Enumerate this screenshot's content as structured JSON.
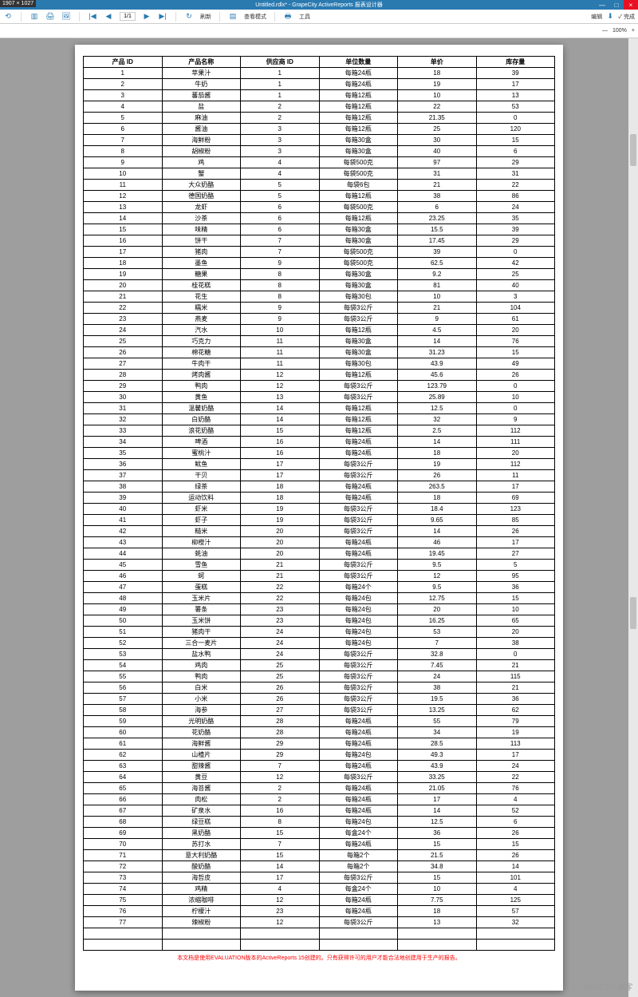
{
  "dim_label": "1907 × 1027",
  "title": "Untitled.rdlx* - GrapeCity ActiveReports 报表设计器",
  "win": {
    "min": "—",
    "max": "□",
    "close": "×"
  },
  "top_toolbar": {
    "edit": "编辑",
    "download_icon": "⬇",
    "done": "✓ 完成",
    "zoom": "100%",
    "plus": "+"
  },
  "sub_toolbar": {
    "back": "⟲",
    "sidebar": "▥",
    "print": "🖨",
    "gallery": "🖼",
    "first": "|◀",
    "prev": "◀",
    "page_current": "1/1",
    "next": "▶",
    "last": "▶|",
    "refresh_icon": "↻",
    "refresh": "刷新",
    "viewmode_icon": "▤",
    "viewmode": "查看模式",
    "export_icon": "🖶",
    "tools": "工具"
  },
  "table": {
    "headers": [
      "产品 ID",
      "产品名称",
      "供应商 ID",
      "单位数量",
      "单价",
      "库存量"
    ],
    "rows": [
      [
        "1",
        "苹果汁",
        "1",
        "每箱24瓶",
        "18",
        "39"
      ],
      [
        "2",
        "牛奶",
        "1",
        "每箱24瓶",
        "19",
        "17"
      ],
      [
        "3",
        "蕃茄酱",
        "1",
        "每箱12瓶",
        "10",
        "13"
      ],
      [
        "4",
        "盐",
        "2",
        "每箱12瓶",
        "22",
        "53"
      ],
      [
        "5",
        "麻油",
        "2",
        "每箱12瓶",
        "21.35",
        "0"
      ],
      [
        "6",
        "酱油",
        "3",
        "每箱12瓶",
        "25",
        "120"
      ],
      [
        "7",
        "海鲜粉",
        "3",
        "每箱30盒",
        "30",
        "15"
      ],
      [
        "8",
        "胡椒粉",
        "3",
        "每箱30盒",
        "40",
        "6"
      ],
      [
        "9",
        "鸡",
        "4",
        "每袋500克",
        "97",
        "29"
      ],
      [
        "10",
        "蟹",
        "4",
        "每袋500克",
        "31",
        "31"
      ],
      [
        "11",
        "大众奶酪",
        "5",
        "每袋6包",
        "21",
        "22"
      ],
      [
        "12",
        "德国奶酪",
        "5",
        "每箱12瓶",
        "38",
        "86"
      ],
      [
        "13",
        "龙虾",
        "6",
        "每袋500克",
        "6",
        "24"
      ],
      [
        "14",
        "沙茶",
        "6",
        "每箱12瓶",
        "23.25",
        "35"
      ],
      [
        "15",
        "味精",
        "6",
        "每箱30盒",
        "15.5",
        "39"
      ],
      [
        "16",
        "饼干",
        "7",
        "每箱30盒",
        "17.45",
        "29"
      ],
      [
        "17",
        "猪肉",
        "7",
        "每袋500克",
        "39",
        "0"
      ],
      [
        "18",
        "墨鱼",
        "9",
        "每袋500克",
        "62.5",
        "42"
      ],
      [
        "19",
        "糖果",
        "8",
        "每箱30盒",
        "9.2",
        "25"
      ],
      [
        "20",
        "桂花糕",
        "8",
        "每箱30盒",
        "81",
        "40"
      ],
      [
        "21",
        "花生",
        "8",
        "每箱30包",
        "10",
        "3"
      ],
      [
        "22",
        "糯米",
        "9",
        "每袋3公斤",
        "21",
        "104"
      ],
      [
        "23",
        "燕麦",
        "9",
        "每袋3公斤",
        "9",
        "61"
      ],
      [
        "24",
        "汽水",
        "10",
        "每箱12瓶",
        "4.5",
        "20"
      ],
      [
        "25",
        "巧克力",
        "11",
        "每箱30盒",
        "14",
        "76"
      ],
      [
        "26",
        "棉花糖",
        "11",
        "每箱30盒",
        "31.23",
        "15"
      ],
      [
        "27",
        "牛肉干",
        "11",
        "每箱30包",
        "43.9",
        "49"
      ],
      [
        "28",
        "烤肉酱",
        "12",
        "每箱12瓶",
        "45.6",
        "26"
      ],
      [
        "29",
        "鸭肉",
        "12",
        "每袋3公斤",
        "123.79",
        "0"
      ],
      [
        "30",
        "黄鱼",
        "13",
        "每袋3公斤",
        "25.89",
        "10"
      ],
      [
        "31",
        "温馨奶酪",
        "14",
        "每箱12瓶",
        "12.5",
        "0"
      ],
      [
        "32",
        "白奶酪",
        "14",
        "每箱12瓶",
        "32",
        "9"
      ],
      [
        "33",
        "浪花奶酪",
        "15",
        "每箱12瓶",
        "2.5",
        "112"
      ],
      [
        "34",
        "啤酒",
        "16",
        "每箱24瓶",
        "14",
        "111"
      ],
      [
        "35",
        "蜜桃汁",
        "16",
        "每箱24瓶",
        "18",
        "20"
      ],
      [
        "36",
        "鱿鱼",
        "17",
        "每袋3公斤",
        "19",
        "112"
      ],
      [
        "37",
        "干贝",
        "17",
        "每袋3公斤",
        "26",
        "11"
      ],
      [
        "38",
        "绿茶",
        "18",
        "每箱24瓶",
        "263.5",
        "17"
      ],
      [
        "39",
        "运动饮料",
        "18",
        "每箱24瓶",
        "18",
        "69"
      ],
      [
        "40",
        "虾米",
        "19",
        "每袋3公斤",
        "18.4",
        "123"
      ],
      [
        "41",
        "虾子",
        "19",
        "每袋3公斤",
        "9.65",
        "85"
      ],
      [
        "42",
        "糙米",
        "20",
        "每袋3公斤",
        "14",
        "26"
      ],
      [
        "43",
        "柳橙汁",
        "20",
        "每箱24瓶",
        "46",
        "17"
      ],
      [
        "44",
        "蚝油",
        "20",
        "每箱24瓶",
        "19.45",
        "27"
      ],
      [
        "45",
        "雪鱼",
        "21",
        "每袋3公斤",
        "9.5",
        "5"
      ],
      [
        "46",
        "蚵",
        "21",
        "每袋3公斤",
        "12",
        "95"
      ],
      [
        "47",
        "蛋糕",
        "22",
        "每箱24个",
        "9.5",
        "36"
      ],
      [
        "48",
        "玉米片",
        "22",
        "每箱24包",
        "12.75",
        "15"
      ],
      [
        "49",
        "薯条",
        "23",
        "每箱24包",
        "20",
        "10"
      ],
      [
        "50",
        "玉米饼",
        "23",
        "每箱24包",
        "16.25",
        "65"
      ],
      [
        "51",
        "猪肉干",
        "24",
        "每箱24包",
        "53",
        "20"
      ],
      [
        "52",
        "三合一麦片",
        "24",
        "每箱24包",
        "7",
        "38"
      ],
      [
        "53",
        "盐水鸭",
        "24",
        "每袋3公斤",
        "32.8",
        "0"
      ],
      [
        "54",
        "鸡肉",
        "25",
        "每袋3公斤",
        "7.45",
        "21"
      ],
      [
        "55",
        "鸭肉",
        "25",
        "每袋3公斤",
        "24",
        "115"
      ],
      [
        "56",
        "白米",
        "26",
        "每袋3公斤",
        "38",
        "21"
      ],
      [
        "57",
        "小米",
        "26",
        "每袋3公斤",
        "19.5",
        "36"
      ],
      [
        "58",
        "海参",
        "27",
        "每袋3公斤",
        "13.25",
        "62"
      ],
      [
        "59",
        "光明奶酪",
        "28",
        "每箱24瓶",
        "55",
        "79"
      ],
      [
        "60",
        "花奶酪",
        "28",
        "每箱24瓶",
        "34",
        "19"
      ],
      [
        "61",
        "海鲜酱",
        "29",
        "每箱24瓶",
        "28.5",
        "113"
      ],
      [
        "62",
        "山楂片",
        "29",
        "每箱24包",
        "49.3",
        "17"
      ],
      [
        "63",
        "甜辣酱",
        "7",
        "每箱24瓶",
        "43.9",
        "24"
      ],
      [
        "64",
        "黄豆",
        "12",
        "每袋3公斤",
        "33.25",
        "22"
      ],
      [
        "65",
        "海苔酱",
        "2",
        "每箱24瓶",
        "21.05",
        "76"
      ],
      [
        "66",
        "肉松",
        "2",
        "每箱24瓶",
        "17",
        "4"
      ],
      [
        "67",
        "矿泉水",
        "16",
        "每箱24瓶",
        "14",
        "52"
      ],
      [
        "68",
        "绿豆糕",
        "8",
        "每箱24包",
        "12.5",
        "6"
      ],
      [
        "69",
        "黑奶酪",
        "15",
        "每盒24个",
        "36",
        "26"
      ],
      [
        "70",
        "苏打水",
        "7",
        "每箱24瓶",
        "15",
        "15"
      ],
      [
        "71",
        "意大利奶酪",
        "15",
        "每箱2个",
        "21.5",
        "26"
      ],
      [
        "72",
        "酸奶酪",
        "14",
        "每箱2个",
        "34.8",
        "14"
      ],
      [
        "73",
        "海哲皮",
        "17",
        "每袋3公斤",
        "15",
        "101"
      ],
      [
        "74",
        "鸡精",
        "4",
        "每盒24个",
        "10",
        "4"
      ],
      [
        "75",
        "浓缩咖啡",
        "12",
        "每箱24瓶",
        "7.75",
        "125"
      ],
      [
        "76",
        "柠檬汁",
        "23",
        "每箱24瓶",
        "18",
        "57"
      ],
      [
        "77",
        "辣椒粉",
        "12",
        "每袋3公斤",
        "13",
        "32"
      ]
    ]
  },
  "eval_notice": "本文档是使用EVALUATION版本的ActiveReports 15创建的。只有获得许可的用户才能合法地创建用于生产的报告。",
  "watermark": "©51CTO博客"
}
